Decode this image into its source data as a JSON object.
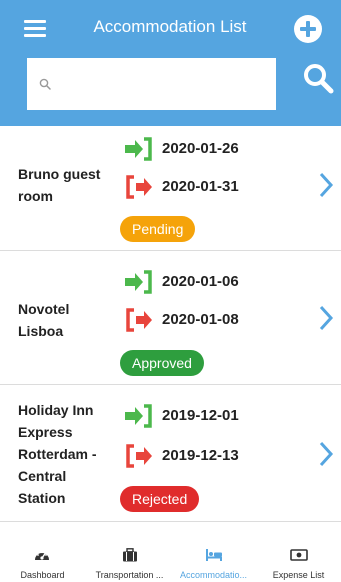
{
  "header": {
    "title": "Accommodation List",
    "menu_icon": "hamburger-menu-icon",
    "add_icon": "plus-circle-icon",
    "search_icon": "search-icon"
  },
  "search": {
    "value": "",
    "placeholder": ""
  },
  "colors": {
    "header_bg": "#55a5e0",
    "checkin": "#4cb84c",
    "checkout": "#e8453c",
    "pending": "#f5a30a",
    "approved": "#2e9e3e",
    "rejected": "#e02c2c",
    "chevron": "#55a5e0"
  },
  "accommodations": [
    {
      "name": "Bruno guest room",
      "checkin": "2020-01-26",
      "checkout": "2020-01-31",
      "status": "Pending"
    },
    {
      "name": "Novotel Lisboa",
      "checkin": "2020-01-06",
      "checkout": "2020-01-08",
      "status": "Approved"
    },
    {
      "name": "Holiday Inn Express Rotterdam - Central Station",
      "checkin": "2019-12-01",
      "checkout": "2019-12-13",
      "status": "Rejected"
    }
  ],
  "tabs": [
    {
      "label": "Dashboard",
      "icon": "speedometer-icon",
      "active": false
    },
    {
      "label": "Transportation ...",
      "icon": "briefcase-icon",
      "active": false
    },
    {
      "label": "Accommodatio...",
      "icon": "bed-icon",
      "active": true
    },
    {
      "label": "Expense List",
      "icon": "money-bill-icon",
      "active": false
    }
  ]
}
